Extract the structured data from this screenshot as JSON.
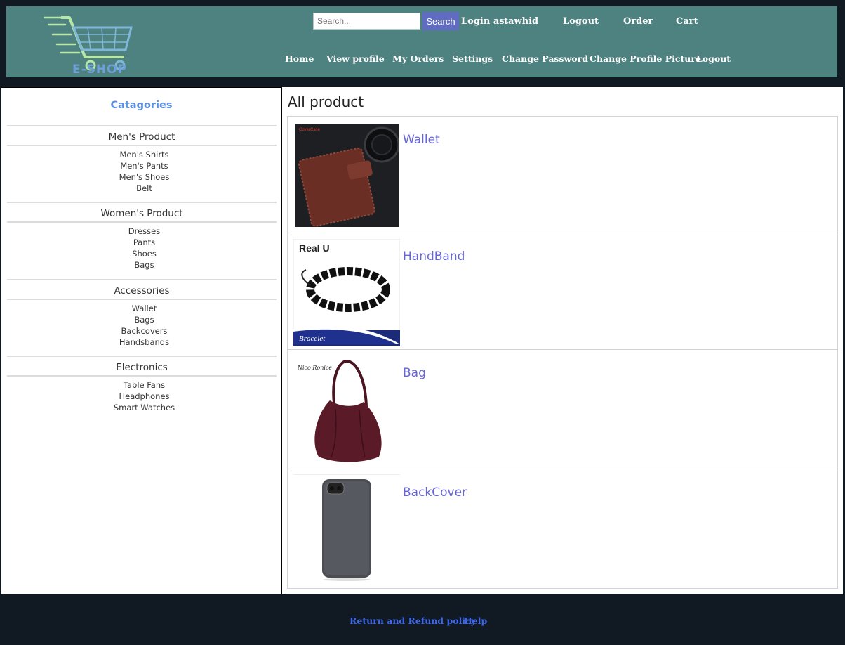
{
  "header": {
    "logo_text": "E-SHOP",
    "search": {
      "placeholder": "Search...",
      "value": "",
      "button_label": "Search"
    },
    "user_bar": {
      "login_as_label": "Login as",
      "username": "tawhid",
      "logout_label": "Logout",
      "order_label": "Order",
      "cart_label": "Cart"
    },
    "nav": [
      "Home",
      "View profile",
      "My Orders",
      "Settings",
      "Change Password",
      "Change Profile Picture",
      "Logout"
    ]
  },
  "sidebar": {
    "title": "Catagories",
    "groups": [
      {
        "heading": "Men's Product",
        "items": [
          "Men's Shirts",
          "Men's Pants",
          "Men's Shoes",
          "Belt"
        ]
      },
      {
        "heading": "Women's Product",
        "items": [
          "Dresses",
          "Pants",
          "Shoes",
          "Bags"
        ]
      },
      {
        "heading": "Accessories",
        "items": [
          "Wallet",
          "Bags",
          "Backcovers",
          "Handsbands"
        ]
      },
      {
        "heading": "Electronics",
        "items": [
          "Table Fans",
          "Headphones",
          "Smart Watches"
        ]
      }
    ]
  },
  "main": {
    "title": "All product",
    "products": [
      {
        "name": "Wallet",
        "image_brand": "CoverCase"
      },
      {
        "name": "HandBand",
        "image_caption_top": "Real U",
        "image_caption_bottom": "Bracelet"
      },
      {
        "name": "Bag",
        "image_brand": "Nico Ronice"
      },
      {
        "name": "BackCover"
      }
    ]
  },
  "footer": {
    "links": [
      "Return and Refund policy",
      "Help"
    ]
  },
  "colors": {
    "header_bg": "#4e8280",
    "page_bg": "#111a22",
    "search_button": "#5f6cbf",
    "category_title": "#5b8fe0",
    "product_link": "#6565d6",
    "footer_link": "#3d66e8"
  }
}
